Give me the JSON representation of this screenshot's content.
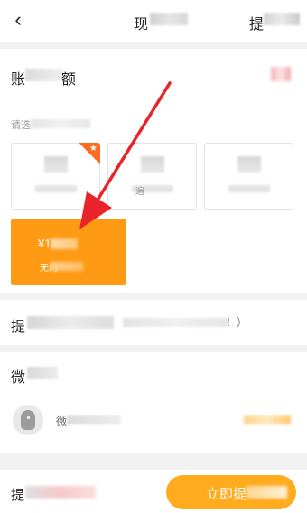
{
  "header": {
    "back_icon": "chevron-left-icon",
    "back_glyph": "‹",
    "title": "现",
    "right_action": "提"
  },
  "balance": {
    "label_start": "账",
    "label_end": "额",
    "select_hint": "请选",
    "value_color": "#f2a8a8"
  },
  "options": [
    {
      "badge": "★",
      "sub_mark": "",
      "selected": false
    },
    {
      "sub_mark": "遍",
      "selected": false
    },
    {
      "sub_mark": "",
      "selected": false
    },
    {
      "amount": "¥1",
      "subtitle": "无门",
      "selected": true
    }
  ],
  "notice": {
    "label": "提",
    "suffix": "！）"
  },
  "account": {
    "title": "微",
    "name": "微",
    "avatar_icon": "avatar-ghost-icon"
  },
  "footer": {
    "label": "提",
    "submit_label": "立即提"
  },
  "colors": {
    "accent_orange": "#ff9a14",
    "button_orange": "#ffab1e",
    "badge_orange": "#ff6a1f",
    "annotation_red": "#e8242a"
  }
}
